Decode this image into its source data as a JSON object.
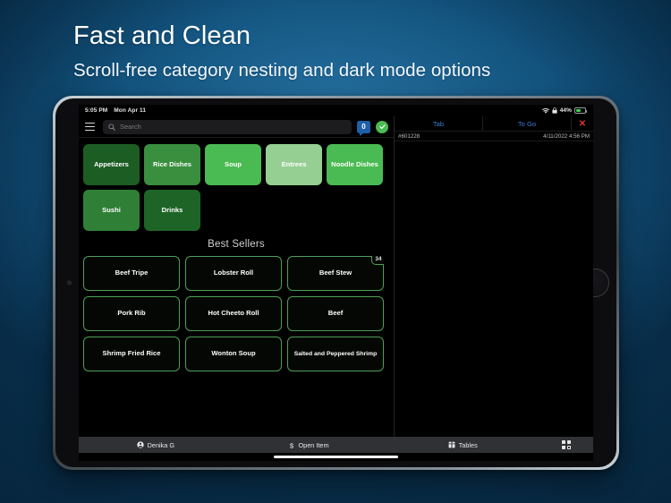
{
  "promo": {
    "title": "Fast and Clean",
    "subtitle": "Scroll-free category nesting and dark mode options"
  },
  "colors": {
    "background_top": "#2b7cab",
    "background_bottom": "#09304d",
    "accent_green": "#4aba52",
    "accent_blue": "#1f5fa8",
    "tab_blue": "#3a7fd5",
    "close_red": "#d83a2e"
  },
  "status_bar": {
    "time": "5:05 PM",
    "date": "Mon Apr 11",
    "battery_percent": "44%",
    "wifi_icon": "wifi-icon",
    "lock_icon": "rotation-lock-icon",
    "battery_icon": "battery-icon"
  },
  "toolbar": {
    "menu_icon": "hamburger-menu-icon",
    "search_icon": "search-icon",
    "search_value": "",
    "search_placeholder": "Search",
    "cart_count": "0",
    "send_icon": "check-circle-icon"
  },
  "categories": [
    {
      "label": "Appetizers",
      "color": "#1c5d24"
    },
    {
      "label": "Rice Dishes",
      "color": "#3a8f3e"
    },
    {
      "label": "Soup",
      "color": "#4aba52"
    },
    {
      "label": "Entrees",
      "color": "#95cf92"
    },
    {
      "label": "Noodle Dishes",
      "color": "#4aba52"
    },
    {
      "label": "Sushi",
      "color": "#2f8036"
    },
    {
      "label": "Drinks",
      "color": "#1f6427"
    }
  ],
  "best_sellers": {
    "title": "Best Sellers",
    "items": [
      {
        "label": "Beef Tripe",
        "qty": ""
      },
      {
        "label": "Lobster Roll",
        "qty": ""
      },
      {
        "label": "Beef Stew",
        "qty": "34"
      },
      {
        "label": "Pork Rib",
        "qty": ""
      },
      {
        "label": "Hot Cheeto Roll",
        "qty": ""
      },
      {
        "label": "Beef",
        "qty": ""
      },
      {
        "label": "Shrimp Fried Rice",
        "qty": ""
      },
      {
        "label": "Wonton Soup",
        "qty": ""
      },
      {
        "label": "Salted and Peppered Shrimp",
        "qty": ""
      }
    ]
  },
  "order_panel": {
    "tabs": [
      {
        "label": "Tab"
      },
      {
        "label": "To Go"
      }
    ],
    "close_label": "✕",
    "order_number": "#601228",
    "order_timestamp": "4/11/2022 4:56 PM"
  },
  "bottom_bar": {
    "user_icon": "person-icon",
    "user_name": "Denika G",
    "open_item_icon": "dollar-icon",
    "open_item_label": "Open Item",
    "tables_icon": "table-icon",
    "tables_label": "Tables",
    "grid_icon": "grid-view-icon"
  }
}
